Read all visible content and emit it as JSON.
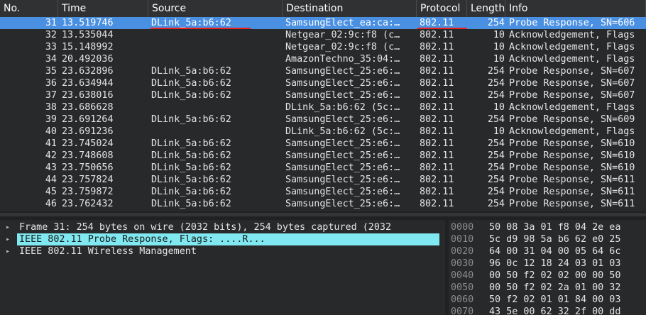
{
  "columns": [
    "No.",
    "Time",
    "Source",
    "Destination",
    "Protocol",
    "Length",
    "Info"
  ],
  "packets": [
    {
      "no": "31",
      "time": "13.519746",
      "src": "DLink_5a:b6:62",
      "dst": "SamsungElect_ea:ca:…",
      "proto": "802.11",
      "len": "254",
      "info": "Probe Response, SN=606",
      "selected": true
    },
    {
      "no": "32",
      "time": "13.535044",
      "src": "",
      "dst": "Netgear_02:9c:f8 (c…",
      "proto": "802.11",
      "len": "10",
      "info": "Acknowledgement, Flags"
    },
    {
      "no": "33",
      "time": "15.148992",
      "src": "",
      "dst": "Netgear_02:9c:f8 (c…",
      "proto": "802.11",
      "len": "10",
      "info": "Acknowledgement, Flags"
    },
    {
      "no": "34",
      "time": "20.492036",
      "src": "",
      "dst": "AmazonTechno_35:04:…",
      "proto": "802.11",
      "len": "10",
      "info": "Acknowledgement, Flags"
    },
    {
      "no": "35",
      "time": "23.632896",
      "src": "DLink_5a:b6:62",
      "dst": "SamsungElect_25:e6:…",
      "proto": "802.11",
      "len": "254",
      "info": "Probe Response, SN=607"
    },
    {
      "no": "36",
      "time": "23.634944",
      "src": "DLink_5a:b6:62",
      "dst": "SamsungElect_25:e6:…",
      "proto": "802.11",
      "len": "254",
      "info": "Probe Response, SN=607"
    },
    {
      "no": "37",
      "time": "23.638016",
      "src": "DLink_5a:b6:62",
      "dst": "SamsungElect_25:e6:…",
      "proto": "802.11",
      "len": "254",
      "info": "Probe Response, SN=607"
    },
    {
      "no": "38",
      "time": "23.686628",
      "src": "",
      "dst": "DLink_5a:b6:62 (5c:…",
      "proto": "802.11",
      "len": "10",
      "info": "Acknowledgement, Flags"
    },
    {
      "no": "39",
      "time": "23.691264",
      "src": "DLink_5a:b6:62",
      "dst": "SamsungElect_25:e6:…",
      "proto": "802.11",
      "len": "254",
      "info": "Probe Response, SN=609"
    },
    {
      "no": "40",
      "time": "23.691236",
      "src": "",
      "dst": "DLink_5a:b6:62 (5c:…",
      "proto": "802.11",
      "len": "10",
      "info": "Acknowledgement, Flags"
    },
    {
      "no": "41",
      "time": "23.745024",
      "src": "DLink_5a:b6:62",
      "dst": "SamsungElect_25:e6:…",
      "proto": "802.11",
      "len": "254",
      "info": "Probe Response, SN=610"
    },
    {
      "no": "42",
      "time": "23.748608",
      "src": "DLink_5a:b6:62",
      "dst": "SamsungElect_25:e6:…",
      "proto": "802.11",
      "len": "254",
      "info": "Probe Response, SN=610"
    },
    {
      "no": "43",
      "time": "23.750656",
      "src": "DLink_5a:b6:62",
      "dst": "SamsungElect_25:e6:…",
      "proto": "802.11",
      "len": "254",
      "info": "Probe Response, SN=610"
    },
    {
      "no": "44",
      "time": "23.757824",
      "src": "DLink_5a:b6:62",
      "dst": "SamsungElect_25:e6:…",
      "proto": "802.11",
      "len": "254",
      "info": "Probe Response, SN=611"
    },
    {
      "no": "45",
      "time": "23.759872",
      "src": "DLink_5a:b6:62",
      "dst": "SamsungElect_25:e6:…",
      "proto": "802.11",
      "len": "254",
      "info": "Probe Response, SN=611"
    },
    {
      "no": "46",
      "time": "23.762432",
      "src": "DLink_5a:b6:62",
      "dst": "SamsungElect_25:e6:…",
      "proto": "802.11",
      "len": "254",
      "info": "Probe Response, SN=611"
    }
  ],
  "details": [
    {
      "arrow": "right-arrow-icon",
      "text": "Frame 31: 254 bytes on wire (2032 bits), 254 bytes captured (2032",
      "highlighted": false
    },
    {
      "arrow": "right-arrow-icon",
      "text": "IEEE 802.11 Probe Response, Flags: ....R...",
      "highlighted": true
    },
    {
      "arrow": "right-arrow-icon",
      "text": "IEEE 802.11 Wireless Management",
      "highlighted": false
    }
  ],
  "hex": [
    {
      "offset": "0000",
      "bytes": "50 08 3a 01 f8 04 2e ea"
    },
    {
      "offset": "0010",
      "bytes": "5c d9 98 5a b6 62 e0 25"
    },
    {
      "offset": "0020",
      "bytes": "64 00 31 04 00 05 64 6c"
    },
    {
      "offset": "0030",
      "bytes": "96 0c 12 18 24 03 01 03"
    },
    {
      "offset": "0040",
      "bytes": "00 50 f2 02 02 00 00 50"
    },
    {
      "offset": "0050",
      "bytes": "00 50 f2 02 2a 01 00 32"
    },
    {
      "offset": "0060",
      "bytes": "50 f2 02 01 01 84 00 03"
    },
    {
      "offset": "0070",
      "bytes": "43 5e 00 62 32 2f 00 dd"
    }
  ],
  "colors": {
    "selection": "#4a90e2",
    "highlight": "#7fe8f0",
    "annotation": "#e8231e"
  }
}
